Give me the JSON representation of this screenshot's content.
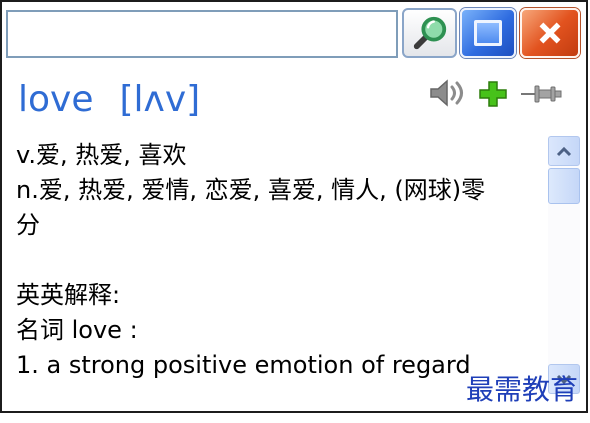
{
  "search": {
    "value": "",
    "placeholder": ""
  },
  "toolbar": {
    "search_button": {
      "icon": "search-icon"
    },
    "maximize_button": {
      "icon": "maximize-icon"
    },
    "close_button": {
      "icon": "close-icon"
    }
  },
  "entry": {
    "word": "love",
    "phonetic": "[lʌv]",
    "actions": {
      "pronounce": {
        "icon": "speaker-icon"
      },
      "add": {
        "icon": "plus-icon"
      },
      "pin": {
        "icon": "pin-icon"
      }
    }
  },
  "definitions": [
    "v.爱, 热爱, 喜欢",
    "n.爱, 热爱, 爱情, 恋爱, 喜爱, 情人, (网球)零分"
  ],
  "english_definitions": {
    "heading": "英英解释:",
    "part_of_speech": "名词 love :",
    "senses": [
      "1. a strong positive emotion of regard"
    ]
  },
  "scrollbar": {
    "position": 0
  },
  "watermark": "最需教育",
  "colors": {
    "headword": "#2f6cd4",
    "text": "#000000",
    "close": "#e2531f",
    "maximize": "#2f6ce0",
    "search_lens": "#8fdcab",
    "plus": "#47c21a",
    "icon_gray": "#8c8c8c",
    "scrollbar": "#c5d7f8",
    "watermark": "#1f3fb8"
  }
}
